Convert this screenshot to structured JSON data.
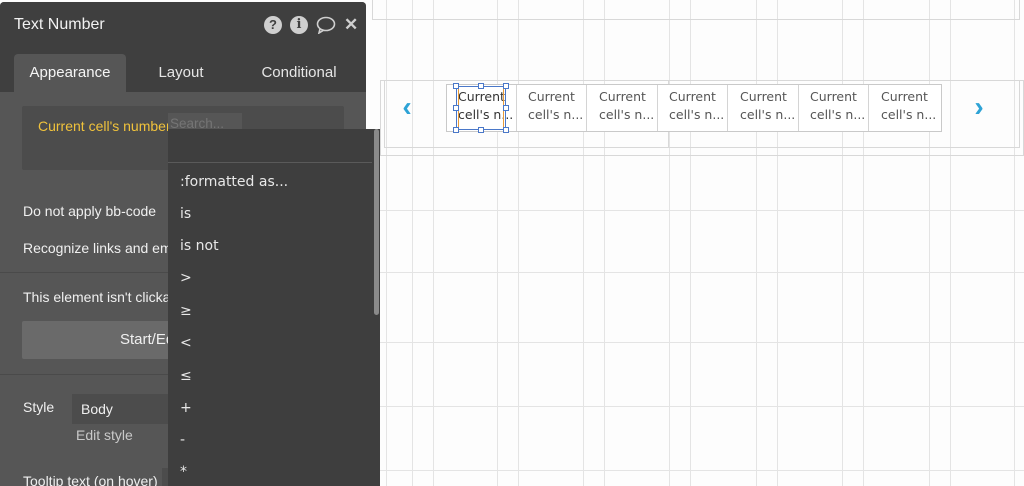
{
  "panel": {
    "title": "Text Number",
    "header_icons": [
      "help-icon",
      "info-icon",
      "comment-icon",
      "close-icon"
    ],
    "help_glyph": "?",
    "info_glyph": "i",
    "close_glyph": "✕",
    "tabs": [
      {
        "label": "Appearance",
        "active": true
      },
      {
        "label": "Layout",
        "active": false
      },
      {
        "label": "Conditional",
        "active": false
      }
    ],
    "expression": "Current cell's number",
    "search_placeholder": "Search...",
    "bbcode_label": "Do not apply bb-code",
    "recognize_label": "Recognize links and ema",
    "clickable_label": "This element isn't clickab",
    "workflow_button": "Start/Ed",
    "style_label": "Style",
    "style_value": "Body",
    "edit_style_link": "Edit style",
    "tooltip_label": "Tooltip text (on hover)"
  },
  "dropdown": {
    "items": [
      ":formatted as...",
      "is",
      "is not",
      ">",
      "≥",
      "<",
      "≤",
      "+",
      "-",
      "*"
    ]
  },
  "repeating_group": {
    "cells": [
      {
        "line1": "Current",
        "line2": "cell's n..."
      },
      {
        "line1": "Current",
        "line2": "cell's n..."
      },
      {
        "line1": "Current",
        "line2": "cell's n..."
      },
      {
        "line1": "Current",
        "line2": "cell's n..."
      },
      {
        "line1": "Current",
        "line2": "cell's n..."
      },
      {
        "line1": "Current",
        "line2": "cell's n..."
      },
      {
        "line1": "Current",
        "line2": "cell's n..."
      }
    ],
    "prev_arrow": "‹",
    "next_arrow": "›"
  },
  "colors": {
    "accent": "#2ea3d6",
    "expression_text": "#f0c23b",
    "panel_bg": "#565656",
    "panel_header": "#3f3f3f",
    "selection": "#4a78c9"
  }
}
